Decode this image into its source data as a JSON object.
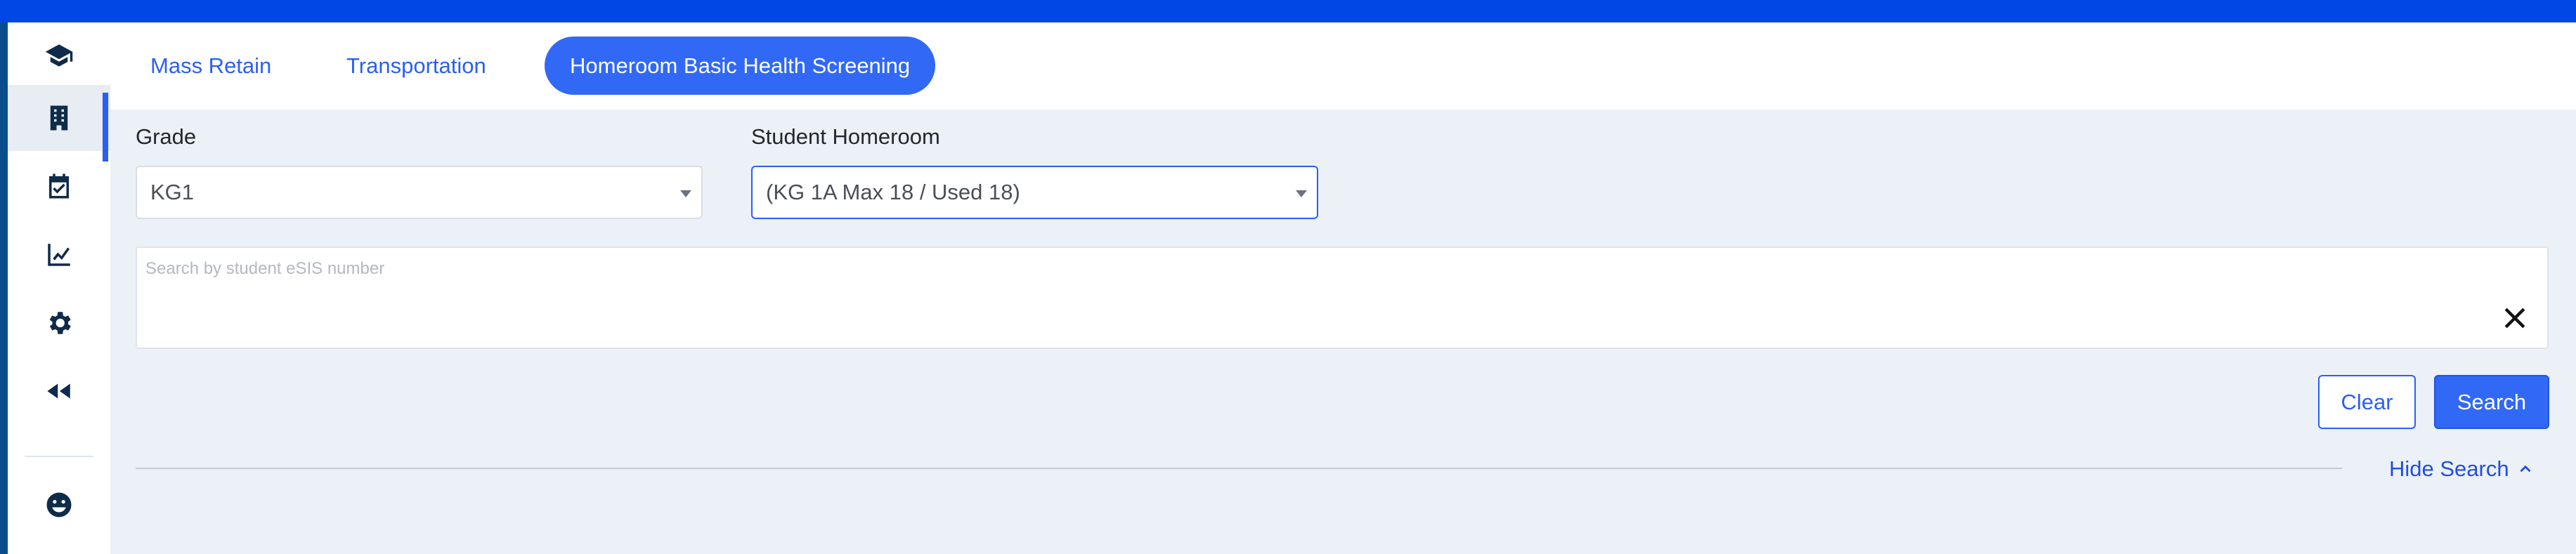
{
  "colors": {
    "top_bar": "#0047e5",
    "accent": "#3169f6",
    "page_bg": "#ecf0f7",
    "sidebar_icon": "#0f2b4a"
  },
  "sidebar": {
    "items": [
      {
        "icon": "graduation-cap-icon",
        "active": false
      },
      {
        "icon": "building-icon",
        "active": true
      },
      {
        "icon": "calendar-check-icon",
        "active": false
      },
      {
        "icon": "chart-line-icon",
        "active": false
      },
      {
        "icon": "gear-icon",
        "active": false
      },
      {
        "icon": "rewind-icon",
        "active": false
      },
      {
        "icon": "smiley-icon",
        "active": false
      }
    ]
  },
  "tabs": [
    {
      "label": "Mass Retain",
      "active": false
    },
    {
      "label": "Transportation",
      "active": false
    },
    {
      "label": "Homeroom Basic Health Screening",
      "active": true
    }
  ],
  "filters": {
    "grade": {
      "label": "Grade",
      "value": "KG1"
    },
    "homeroom": {
      "label": "Student Homeroom",
      "value": "(KG 1A Max 18 / Used 18)"
    }
  },
  "search": {
    "placeholder": "Search by student eSIS number",
    "value": ""
  },
  "buttons": {
    "clear": "Clear",
    "search": "Search"
  },
  "hide_search": "Hide Search"
}
